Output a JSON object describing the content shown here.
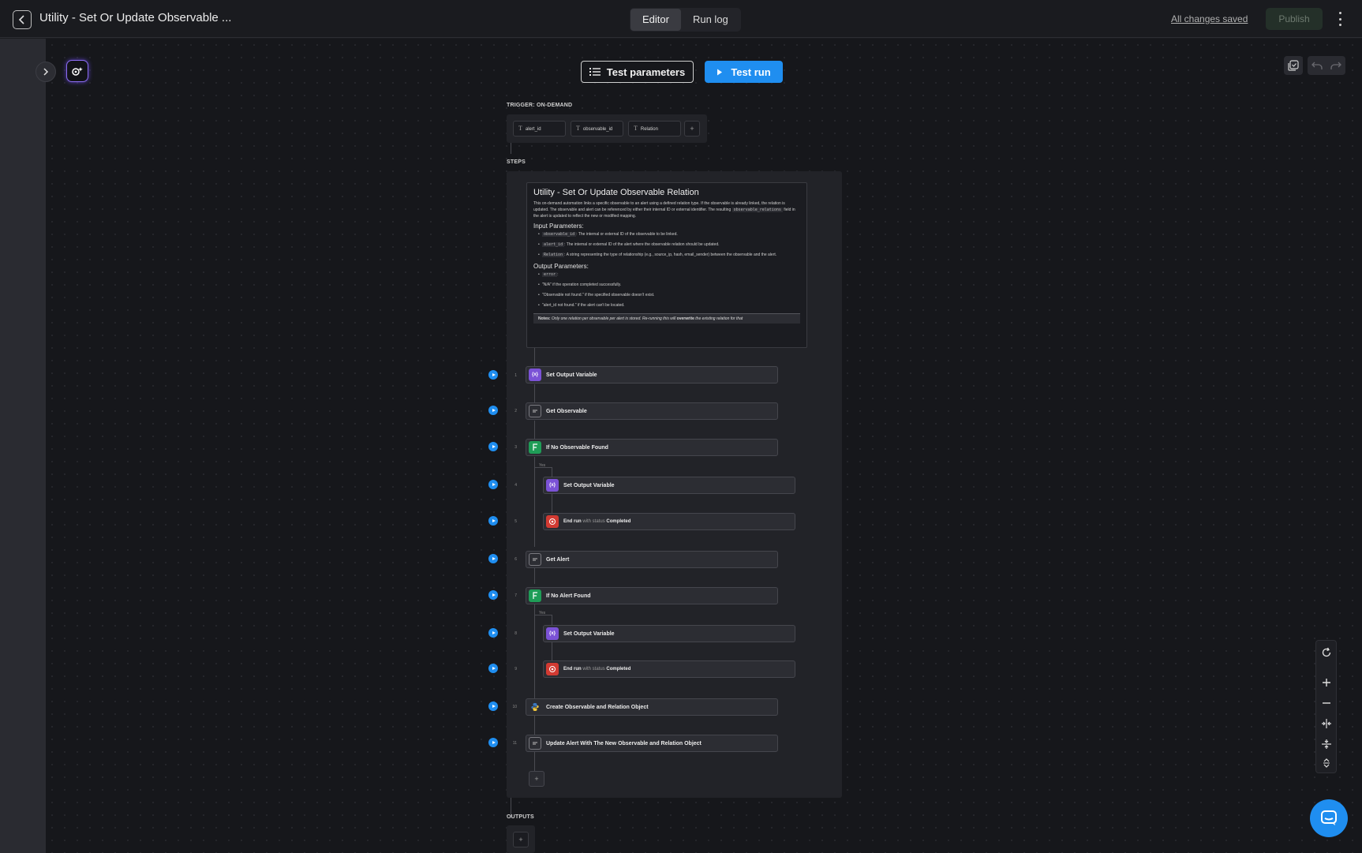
{
  "header": {
    "title": "Utility - Set Or Update Observable ...",
    "tabs": [
      {
        "label": "Editor"
      },
      {
        "label": "Run log"
      }
    ],
    "saved_status": "All changes saved",
    "publish_label": "Publish"
  },
  "toolbar": {
    "test_parameters_label": "Test parameters",
    "test_run_label": "Test run"
  },
  "trigger": {
    "label": "TRIGGER: ON-DEMAND",
    "params": [
      "alert_id",
      "observable_id",
      "Relation"
    ],
    "add_label": "+"
  },
  "steps_label": "STEPS",
  "outputs_label": "OUTPUTS",
  "note": {
    "title": "Utility - Set Or Update Observable Relation",
    "intro_1": "This on-demand automation links a specific observable to an alert using a defined relation type. If the observable is already linked, the relation is updated. The observable and alert can be referenced by either their internal ID or external identifier. The resulting",
    "intro_code": "observable_relations",
    "intro_2": "field in the alert is updated to reflect the new or modified mapping.",
    "input_heading": "Input Parameters:",
    "inputs": [
      {
        "code": "observable_id",
        "text": ": The internal or external ID of the observable to be linked."
      },
      {
        "code": "alert_id",
        "text": ": The internal or external ID of the alert where the observable relation should be updated."
      },
      {
        "code": "Relation",
        "text": ": A string representing the type of relationship (e.g., source_ip, hash, email_sender) between the observable and the alert."
      }
    ],
    "output_heading": "Output Parameters:",
    "output_code": "error",
    "outputs": [
      "\"N/A\" if the operation completed successfully.",
      "\"Observable not found.\" if the specified observable doesn't exist.",
      "\"alert_id not found.\" if the alert can't be located."
    ],
    "callout_bold": "Notes:",
    "callout_text_1": "Only one relation per observable per alert is stored. Re-running this will",
    "callout_bold_2": "overwrite",
    "callout_text_2": "the existing relation for that"
  },
  "steps": [
    {
      "num": "1",
      "label": "Set Output Variable",
      "icon": "variable-icon"
    },
    {
      "num": "2",
      "label": "Get Observable",
      "icon": "clipboard-icon"
    },
    {
      "num": "3",
      "label": "If No Observable Found",
      "icon": "branch-icon"
    },
    {
      "num": "4",
      "label": "Set Output Variable",
      "icon": "variable-icon"
    },
    {
      "num": "5",
      "label": "End run",
      "status_prefix": "with status",
      "status": "Completed",
      "icon": "stop-icon"
    },
    {
      "num": "6",
      "label": "Get Alert",
      "icon": "clipboard-icon"
    },
    {
      "num": "7",
      "label": "If No Alert Found",
      "icon": "branch-icon"
    },
    {
      "num": "8",
      "label": "Set Output Variable",
      "icon": "variable-icon"
    },
    {
      "num": "9",
      "label": "End run",
      "status_prefix": "with status",
      "status": "Completed",
      "icon": "stop-icon"
    },
    {
      "num": "10",
      "label": "Create Observable and Relation Object",
      "icon": "python-icon"
    },
    {
      "num": "11",
      "label": "Update Alert With The New Observable and Relation Object",
      "icon": "clipboard-icon"
    }
  ],
  "yes_label": "Yes",
  "variable_glyph": "{x}",
  "add_step_label": "+",
  "colors": {
    "accent": "#1f8ef0",
    "variable": "#7b52d6",
    "condition": "#1f9d57",
    "stop": "#d23a32"
  }
}
